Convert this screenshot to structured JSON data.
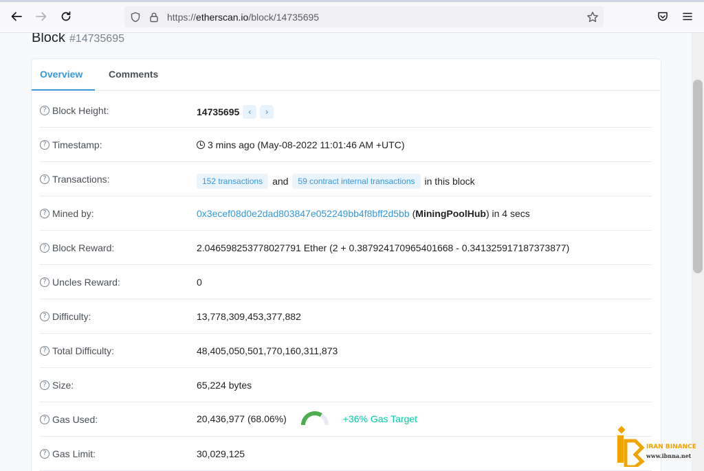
{
  "browser": {
    "url_prefix": "https://",
    "url_host": "etherscan.io",
    "url_path": "/block/14735695"
  },
  "page": {
    "title": "Block",
    "block_number": "#14735695"
  },
  "tabs": [
    {
      "label": "Overview"
    },
    {
      "label": "Comments"
    }
  ],
  "rows": {
    "height": {
      "label": "Block Height:",
      "value": "14735695"
    },
    "timestamp": {
      "label": "Timestamp:",
      "value": "3 mins ago (May-08-2022 11:01:46 AM +UTC)"
    },
    "transactions": {
      "label": "Transactions:",
      "tx_badge": "152 transactions",
      "and": "and",
      "internal_badge": "59 contract internal transactions",
      "suffix": "in this block"
    },
    "mined_by": {
      "label": "Mined by:",
      "address": "0x3ecef08d0e2dad803847e052249bb4f8bff2d5bb",
      "open_paren": "(",
      "pool": "MiningPoolHub",
      "suffix": ") in 4 secs"
    },
    "reward": {
      "label": "Block Reward:",
      "value": "2.046598253778027791 Ether (2 + 0.387924170965401668 - 0.341325917187373877)"
    },
    "uncles": {
      "label": "Uncles Reward:",
      "value": "0"
    },
    "difficulty": {
      "label": "Difficulty:",
      "value": "13,778,309,453,377,882"
    },
    "total_difficulty": {
      "label": "Total Difficulty:",
      "value": "48,405,050,501,770,160,311,873"
    },
    "size": {
      "label": "Size:",
      "value": "65,224 bytes"
    },
    "gas_used": {
      "label": "Gas Used:",
      "value": "20,436,977 (68.06%)",
      "gauge_fraction": 0.6806,
      "target": "+36% Gas Target"
    },
    "gas_limit": {
      "label": "Gas Limit:",
      "value": "30,029,125"
    }
  },
  "watermark": {
    "name": "IRAN BINANCE",
    "site": "www.ibnna.net"
  },
  "colors": {
    "accent": "#3498db",
    "gas_target": "#00c9a7",
    "gauge_fill": "#4cae4f",
    "gauge_track": "#e7eaf3"
  }
}
